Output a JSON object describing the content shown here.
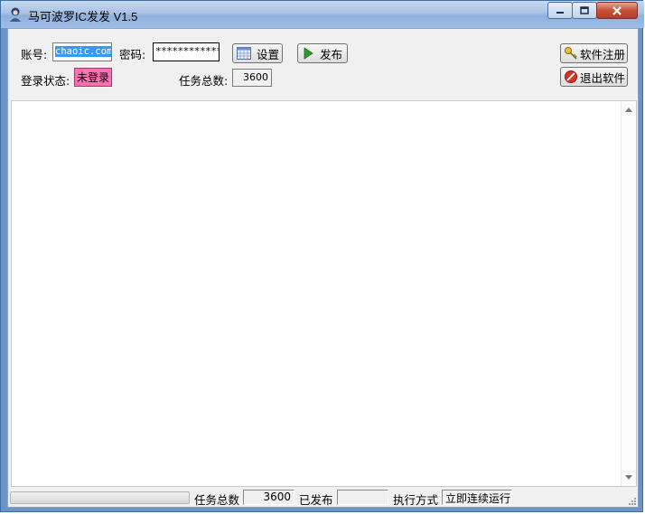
{
  "window": {
    "title": "马可波罗IC发发 V1.5",
    "accent": "#3399ff",
    "status_color": "#ff6fb3"
  },
  "icons": [
    "app-icon",
    "minimize-icon",
    "maximize-icon",
    "close-icon",
    "calendar-grid-icon",
    "play-icon",
    "key-icon",
    "no-entry-icon",
    "resize-grip-icon"
  ],
  "login": {
    "account_label": "账号:",
    "account_value": "chaoic.com",
    "password_label": "密码:",
    "password_value": "************",
    "settings_button": "设置",
    "publish_button": "发布",
    "status_label": "登录状态:",
    "status_value": "未登录",
    "task_total_label": "任务总数:",
    "task_total_value": "3600"
  },
  "side_buttons": {
    "register": "软件注册",
    "exit": "退出软件"
  },
  "statusbar": {
    "progress": 0,
    "task_total_label": "任务总数",
    "task_total_value": "3600",
    "published_label": "已发布",
    "published_value": "",
    "mode_label": "执行方式",
    "mode_value": "立即连续运行"
  }
}
